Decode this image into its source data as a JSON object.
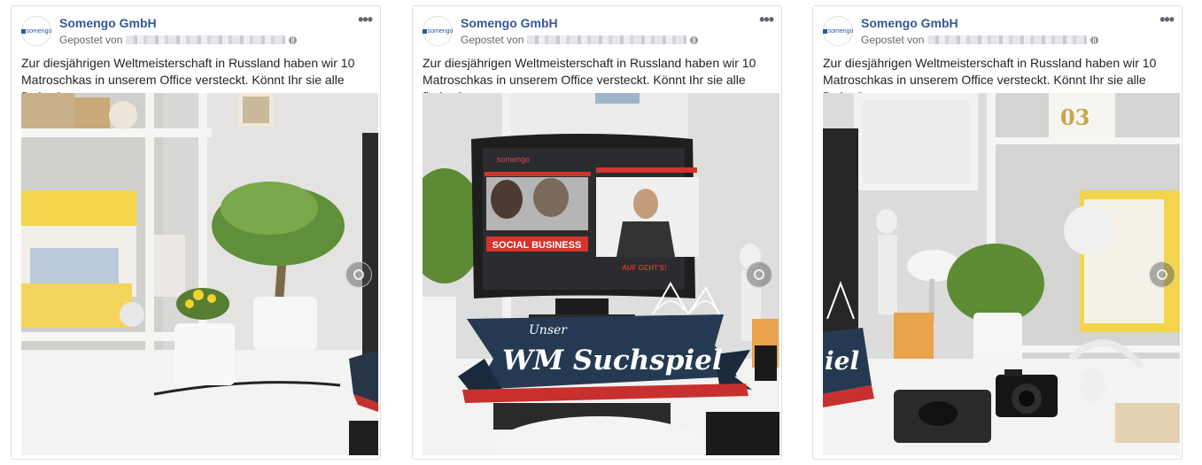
{
  "posts": [
    {
      "page_name": "Somengo GmbH",
      "avatar_text": "somengo",
      "posted_by": "Gepostet von",
      "text": "Zur diesjährigen Weltmeisterschaft in Russland haben wir 10 Matroschkas in unserem Office versteckt. Könnt Ihr sie alle finden?",
      "more": "•••"
    },
    {
      "page_name": "Somengo GmbH",
      "avatar_text": "somengo",
      "posted_by": "Gepostet von",
      "text": "Zur diesjährigen Weltmeisterschaft in Russland haben wir 10 Matroschkas in unserem Office versteckt. Könnt Ihr sie alle finden?",
      "more": "•••",
      "photo": {
        "monitor_brand": "somengo",
        "banner_left": "SOCIAL BUSINESS",
        "banner_right": "AUF GEHT'S!",
        "sign_small": "Unser",
        "sign_big": "WM Suchspiel"
      }
    },
    {
      "page_name": "Somengo GmbH",
      "avatar_text": "somengo",
      "posted_by": "Gepostet von",
      "text": "Zur diesjährigen Weltmeisterschaft in Russland haben wir 10 Matroschkas in unserem Office versteckt. Könnt Ihr sie alle finden?",
      "more": "•••",
      "photo": {
        "box_number": "03",
        "sign_fragment": "iel"
      }
    }
  ],
  "colors": {
    "link": "#365899",
    "text": "#1d2129",
    "meta": "#616770",
    "border": "#dddfe2"
  }
}
